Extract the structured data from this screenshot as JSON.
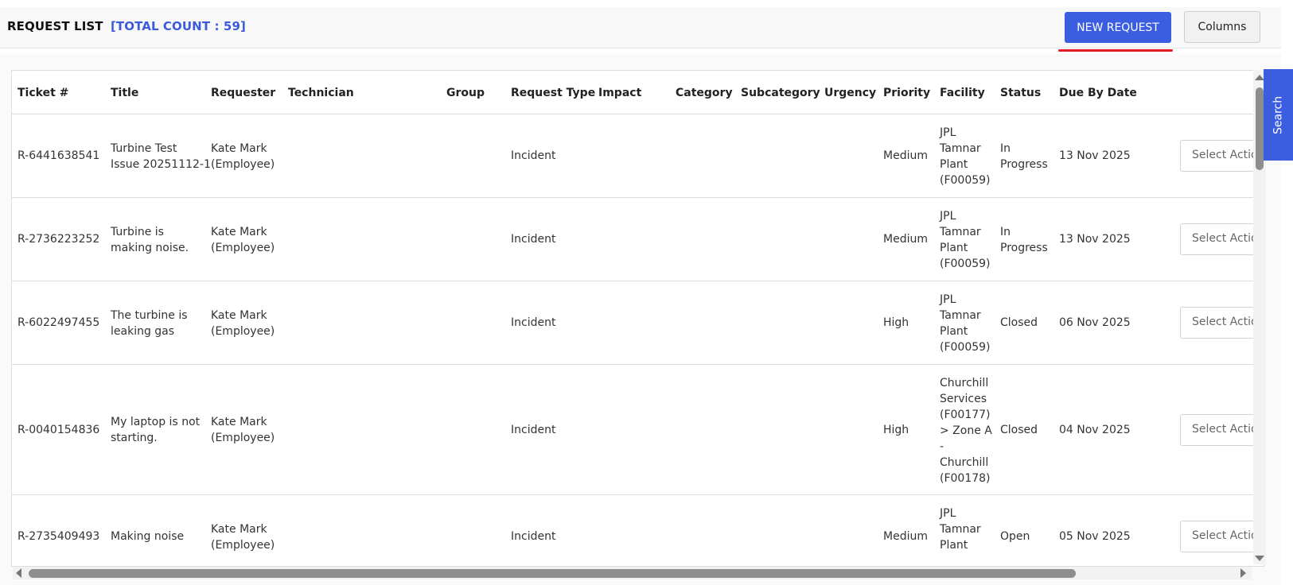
{
  "header": {
    "title": "REQUEST LIST",
    "count_label": "[TOTAL COUNT : 59]",
    "new_request_label": "NEW REQUEST",
    "columns_label": "Columns"
  },
  "side_tab": {
    "search_label": "Search"
  },
  "table": {
    "columns": [
      "Ticket #",
      "Title",
      "Requester",
      "Technician",
      "Group",
      "Request Type",
      "Impact",
      "Category",
      "Subcategory",
      "Urgency",
      "Priority",
      "Facility",
      "Status",
      "Due By Date"
    ],
    "action_placeholder": "Select Action",
    "rows": [
      {
        "ticket": "R-6441638541",
        "title": [
          "Turbine Test",
          "Issue 20251112-1"
        ],
        "requester": [
          "Kate Mark",
          "(Employee)"
        ],
        "request_type": "Incident",
        "priority": "Medium",
        "facility": [
          "JPL",
          "Tamnar",
          "Plant",
          "(F00059)"
        ],
        "status": [
          "In",
          "Progress"
        ],
        "due": "13 Nov 2025"
      },
      {
        "ticket": "R-2736223252",
        "title": [
          "Turbine is",
          "making noise."
        ],
        "requester": [
          "Kate Mark",
          "(Employee)"
        ],
        "request_type": "Incident",
        "priority": "Medium",
        "facility": [
          "JPL",
          "Tamnar",
          "Plant",
          "(F00059)"
        ],
        "status": [
          "In",
          "Progress"
        ],
        "due": "13 Nov 2025"
      },
      {
        "ticket": "R-6022497455",
        "title": [
          "The turbine is",
          "leaking gas"
        ],
        "requester": [
          "Kate Mark",
          "(Employee)"
        ],
        "request_type": "Incident",
        "priority": "High",
        "facility": [
          "JPL",
          "Tamnar",
          "Plant",
          "(F00059)"
        ],
        "status": [
          "Closed"
        ],
        "due": "06 Nov 2025"
      },
      {
        "ticket": "R-0040154836",
        "title": [
          "My laptop is not",
          "starting."
        ],
        "requester": [
          "Kate Mark",
          "(Employee)"
        ],
        "request_type": "Incident",
        "priority": "High",
        "facility": [
          "Churchill",
          "Services",
          "(F00177)",
          "> Zone A",
          "-",
          "Churchill",
          "(F00178)"
        ],
        "status": [
          "Closed"
        ],
        "due": "04 Nov 2025"
      },
      {
        "ticket": "R-2735409493",
        "title": [
          "Making noise"
        ],
        "requester": [
          "Kate Mark",
          "(Employee)"
        ],
        "request_type": "Incident",
        "priority": "Medium",
        "facility": [
          "JPL",
          "Tamnar",
          "Plant"
        ],
        "status": [
          "Open"
        ],
        "due": "05 Nov 2025"
      }
    ]
  }
}
